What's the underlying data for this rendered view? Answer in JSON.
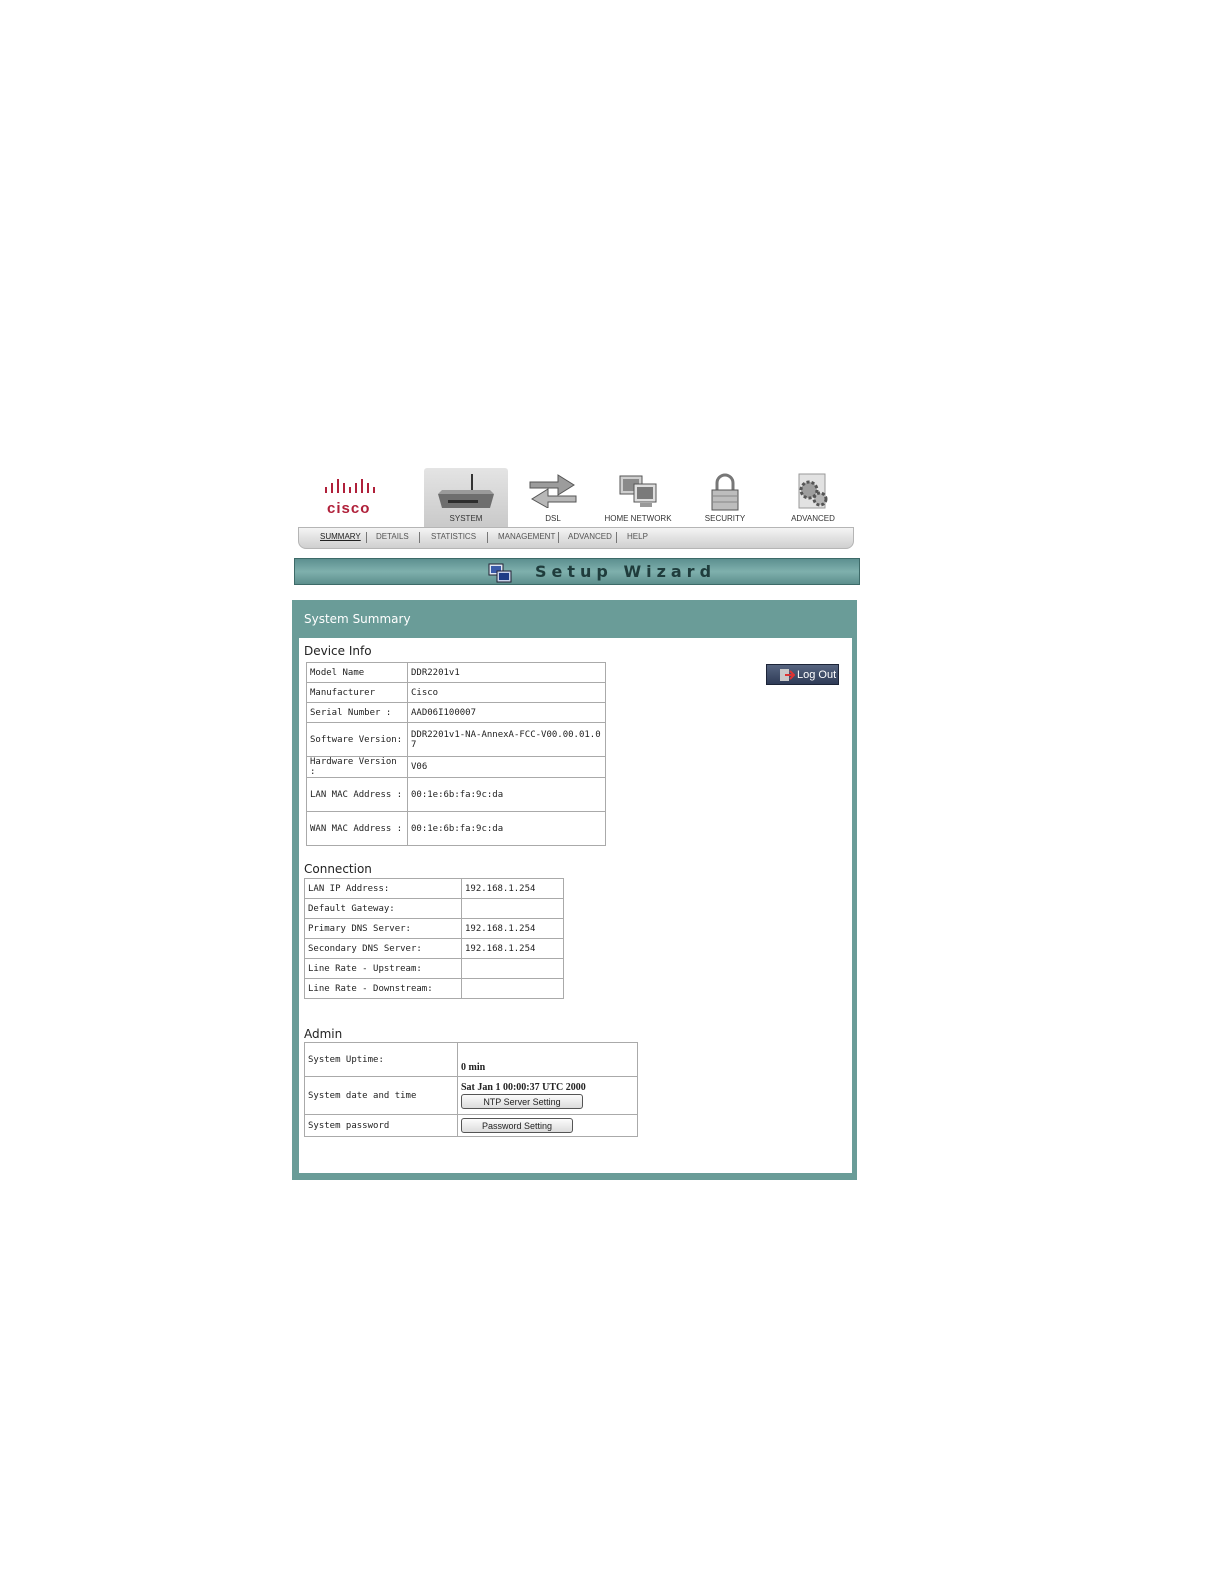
{
  "brand": {
    "logo_text": "cisco"
  },
  "nav": {
    "tabs": [
      {
        "label": "SYSTEM",
        "icon": "router-icon",
        "active": true
      },
      {
        "label": "DSL",
        "icon": "arrows-icon",
        "active": false
      },
      {
        "label": "HOME NETWORK",
        "icon": "computers-icon",
        "active": false
      },
      {
        "label": "SECURITY",
        "icon": "padlock-icon",
        "active": false
      },
      {
        "label": "ADVANCED",
        "icon": "gears-icon",
        "active": false
      }
    ]
  },
  "subnav": {
    "items": [
      {
        "label": "SUMMARY",
        "active": true
      },
      {
        "label": "DETAILS",
        "active": false
      },
      {
        "label": "STATISTICS",
        "active": false
      },
      {
        "label": "MANAGEMENT",
        "active": false
      },
      {
        "label": "ADVANCED",
        "active": false
      },
      {
        "label": "HELP",
        "active": false
      }
    ]
  },
  "wizard": {
    "label": "Setup Wizard"
  },
  "panel": {
    "title": "System Summary",
    "logout_label": "Log Out",
    "device_info": {
      "title": "Device Info",
      "rows": [
        {
          "label": "Model Name",
          "value": "DDR2201v1"
        },
        {
          "label": "Manufacturer",
          "value": "Cisco"
        },
        {
          "label": "Serial Number :",
          "value": "AAD06I100007"
        },
        {
          "label": "Software Version:",
          "value": "DDR2201v1-NA-AnnexA-FCC-V00.00.01.07"
        },
        {
          "label": "Hardware Version :",
          "value": "V06"
        },
        {
          "label": "LAN MAC Address :",
          "value": "00:1e:6b:fa:9c:da"
        },
        {
          "label": "WAN MAC Address :",
          "value": "00:1e:6b:fa:9c:da"
        }
      ]
    },
    "connection": {
      "title": "Connection",
      "rows": [
        {
          "label": "LAN IP Address:",
          "value": "192.168.1.254"
        },
        {
          "label": "Default Gateway:",
          "value": ""
        },
        {
          "label": "Primary DNS Server:",
          "value": "192.168.1.254"
        },
        {
          "label": "Secondary DNS Server:",
          "value": "192.168.1.254"
        },
        {
          "label": "Line Rate - Upstream:",
          "value": ""
        },
        {
          "label": "Line Rate - Downstream:",
          "value": ""
        }
      ]
    },
    "admin": {
      "title": "Admin",
      "uptime_label": "System Uptime:",
      "uptime_value": "0 min",
      "datetime_label": "System date and time",
      "datetime_value": "Sat Jan 1 00:00:37 UTC 2000",
      "ntp_button": "NTP Server Setting",
      "password_label": "System password",
      "password_button": "Password Setting"
    }
  },
  "colors": {
    "panel": "#6a9c98",
    "brand": "#b0203a",
    "logout": "#2e3b57"
  }
}
